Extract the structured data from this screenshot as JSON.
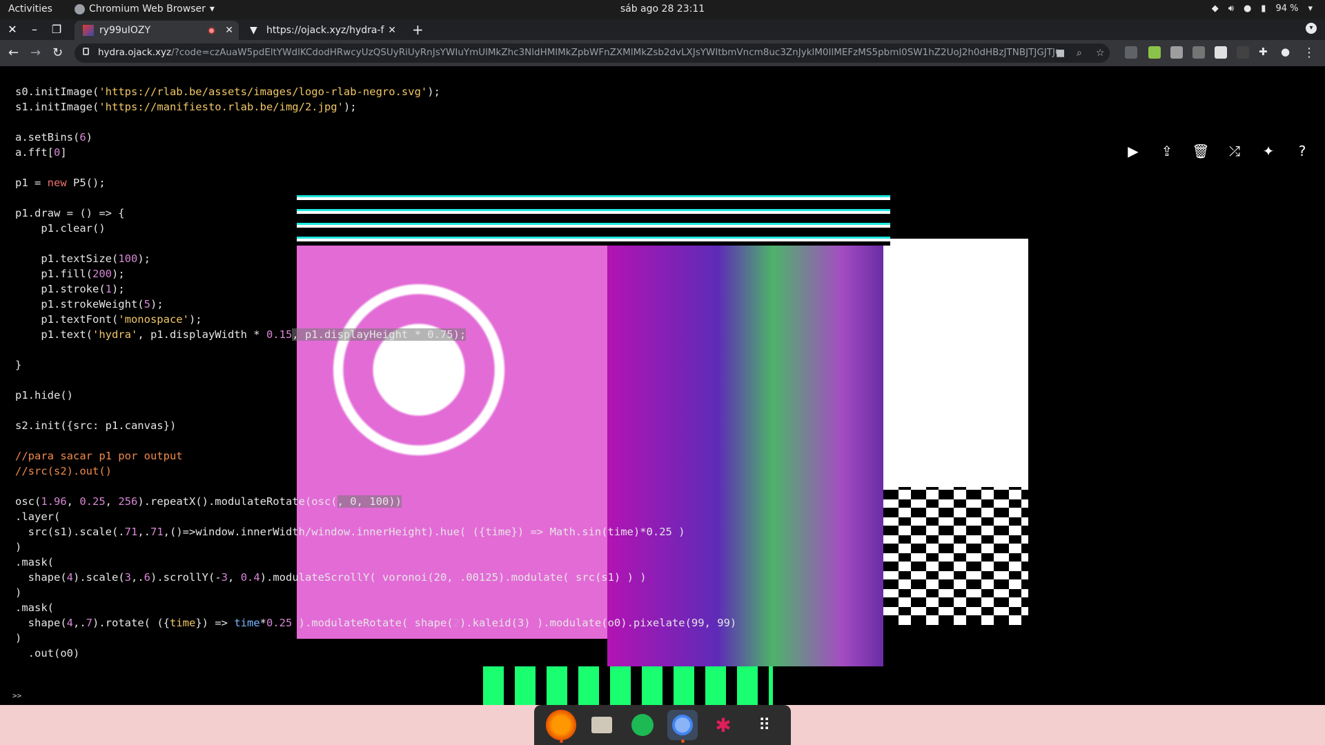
{
  "topbar": {
    "activities": "Activities",
    "app_name": "Chromium Web Browser",
    "clock": "sáb ago 28  23:11",
    "battery": "94 %"
  },
  "tabs": [
    {
      "title": "ry99uIOZY",
      "active": true
    },
    {
      "title": "https://ojack.xyz/hydra-f",
      "active": false
    }
  ],
  "address_bar": {
    "host": "hydra.ojack.xyz",
    "path": "/?code=czAuaW5pdEltYWdlKCdodHRwcyUzQSUyRiUyRnJsYWIuYmUlMkZhc3NldHMlMkZpbWFnZXMlMkZsb2dvLXJsYWItbmVncm8uc3ZnJyklM0IlMEFzMS5pbml0SW1hZ2UoJ2h0dHBzJTNBJTJGJTJGb..."
  },
  "code_lines": [
    [
      [
        "s0.initImage(",
        ""
      ],
      [
        "'https://rlab.be/assets/images/logo-rlab-negro.svg'",
        "str"
      ],
      [
        ");",
        ""
      ]
    ],
    [
      [
        "s1.initImage(",
        ""
      ],
      [
        "'https://manifiesto.rlab.be/img/2.jpg'",
        "str"
      ],
      [
        ");",
        ""
      ]
    ],
    [],
    [
      [
        "a.setBins(",
        ""
      ],
      [
        "6",
        "num"
      ],
      [
        ")",
        ""
      ]
    ],
    [
      [
        "a.fft[",
        ""
      ],
      [
        "0",
        "num"
      ],
      [
        "]",
        ""
      ]
    ],
    [],
    [
      [
        "p1 = ",
        ""
      ],
      [
        "new",
        "kw"
      ],
      [
        " P5();",
        ""
      ]
    ],
    [],
    [
      [
        "p1.draw = () => {",
        ""
      ]
    ],
    [
      [
        "    p1.clear()",
        ""
      ]
    ],
    [],
    [
      [
        "    p1.textSize(",
        ""
      ],
      [
        "100",
        "num"
      ],
      [
        ");",
        ""
      ]
    ],
    [
      [
        "    p1.fill(",
        ""
      ],
      [
        "200",
        "num"
      ],
      [
        ");",
        ""
      ]
    ],
    [
      [
        "    p1.stroke(",
        ""
      ],
      [
        "1",
        "num"
      ],
      [
        ");",
        ""
      ]
    ],
    [
      [
        "    p1.strokeWeight(",
        ""
      ],
      [
        "5",
        "num"
      ],
      [
        ");",
        ""
      ]
    ],
    [
      [
        "    p1.textFont(",
        ""
      ],
      [
        "'monospace'",
        "str"
      ],
      [
        ");",
        ""
      ]
    ],
    [
      [
        "    p1.text(",
        ""
      ],
      [
        "'hydra'",
        "str"
      ],
      [
        ", p1.displayWidth * ",
        ""
      ],
      [
        "0.15",
        "num"
      ],
      [
        ", p1.displayHeight * 0.75);",
        "hl"
      ]
    ],
    [],
    [
      [
        "}",
        ""
      ]
    ],
    [],
    [
      [
        "p1.hide()",
        ""
      ]
    ],
    [],
    [
      [
        "s2.init({src: p1.canvas})",
        ""
      ]
    ],
    [],
    [
      [
        "//para sacar p1 por output",
        "cm"
      ]
    ],
    [
      [
        "//src(s2).out()",
        "cm"
      ]
    ],
    [],
    [
      [
        "osc(",
        ""
      ],
      [
        "1.96",
        "num"
      ],
      [
        ", ",
        ""
      ],
      [
        "0.25",
        "num"
      ],
      [
        ", ",
        ""
      ],
      [
        "256",
        "num"
      ],
      [
        ").repeatX().modulateRotate(osc(",
        ""
      ],
      [
        ", 0, 100))",
        "hl"
      ]
    ],
    [
      [
        ".layer(",
        ""
      ]
    ],
    [
      [
        "  src(s1).scale(.",
        ""
      ],
      [
        "71",
        "num"
      ],
      [
        ",.",
        ""
      ],
      [
        "71",
        "num"
      ],
      [
        ",(",
        ""
      ],
      [
        ")=>window.innerWidth/window.innerHeight).hue( ({time}) => Math.sin(time)*0.25 )",
        ""
      ]
    ],
    [
      [
        ")",
        ""
      ]
    ],
    [
      [
        ".mask(",
        ""
      ]
    ],
    [
      [
        "  shape(",
        ""
      ],
      [
        "4",
        "num"
      ],
      [
        ").scale(",
        ""
      ],
      [
        "3",
        "num"
      ],
      [
        ",.",
        ""
      ],
      [
        "6",
        "num"
      ],
      [
        ").scrollY(-",
        ""
      ],
      [
        "3",
        "num"
      ],
      [
        ", ",
        ""
      ],
      [
        "0.4",
        "num"
      ],
      [
        ").modulateScrollY( voronoi(20, .00125).modulate( src(s1) ) )",
        ""
      ]
    ],
    [
      [
        ")",
        ""
      ]
    ],
    [
      [
        ".mask(",
        ""
      ]
    ],
    [
      [
        "  shape(",
        ""
      ],
      [
        "4",
        "num"
      ],
      [
        ",.",
        ""
      ],
      [
        "7",
        "num"
      ],
      [
        ").rotate( ({",
        ""
      ],
      [
        "time",
        "str"
      ],
      [
        "}) => ",
        ""
      ],
      [
        "time",
        "prop"
      ],
      [
        "*",
        ""
      ],
      [
        "0.25",
        "num"
      ],
      [
        " ).modulateRotate( shape(",
        ""
      ],
      [
        "2",
        "num"
      ],
      [
        ").kaleid(3) ).modulate(o0).pixelate(99, 99)",
        ""
      ]
    ],
    [
      [
        ")",
        ""
      ]
    ],
    [
      [
        "  .out(o0)",
        ""
      ]
    ]
  ],
  "prompt": ">>",
  "hydra_toolbar": [
    "run-icon",
    "share-icon",
    "clear-icon",
    "shuffle-icon",
    "gallery-icon",
    "help-icon"
  ],
  "dock": [
    "Firefox",
    "Files",
    "Spotify",
    "Chromium",
    "Slack",
    "Show Applications"
  ]
}
